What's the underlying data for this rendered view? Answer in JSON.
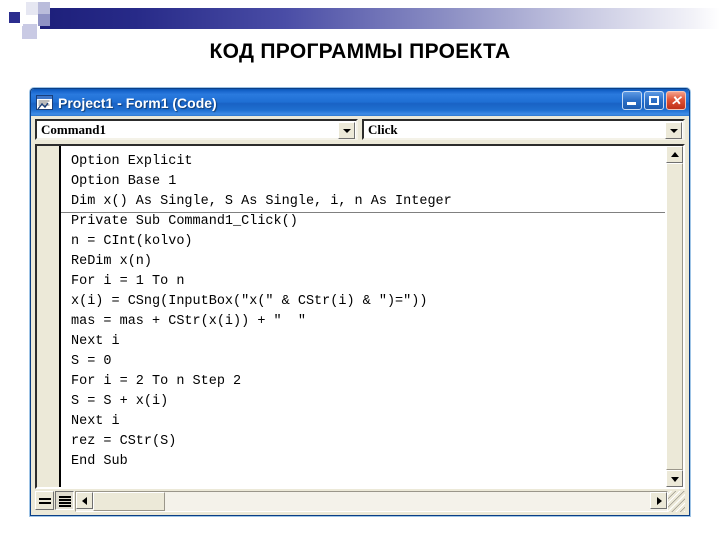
{
  "slide": {
    "heading": "КОД ПРОГРАММЫ ПРОЕКТА",
    "decoration": "blue-gradient-banner"
  },
  "window": {
    "title": "Project1 - Form1 (Code)",
    "icon": "vb-code-window-icon",
    "controls": {
      "minimize_label": "_",
      "maximize_label": "□",
      "close_label": "✕"
    },
    "colors": {
      "titlebar_start": "#2a7ade",
      "titlebar_end": "#1962c4",
      "close_red": "#df5336",
      "face": "#ece9d8",
      "code_background": "#ffffff",
      "code_text": "#000000"
    }
  },
  "toolbar": {
    "object_combo": {
      "value": "Command1",
      "arrow": "chevron-down-icon"
    },
    "procedure_combo": {
      "value": "Click",
      "arrow": "chevron-down-icon"
    }
  },
  "code": {
    "separator_after_line": 3,
    "lines": [
      "Option Explicit",
      "Option Base 1",
      "Dim x() As Single, S As Single, i, n As Integer",
      "Private Sub Command1_Click()",
      "n = CInt(kolvo)",
      "ReDim x(n)",
      "For i = 1 To n",
      "x(i) = CSng(InputBox(\"x(\" & CStr(i) & \")=\"))",
      "mas = mas + CStr(x(i)) + \"  \"",
      "Next i",
      "S = 0",
      "For i = 2 To n Step 2",
      "S = S + x(i)",
      "Next i",
      "rez = CStr(S)",
      "End Sub"
    ]
  },
  "bottombar": {
    "procedure_view_label": "procedure-view",
    "full_module_view_label": "full-module-view"
  },
  "scrollbars": {
    "vertical_up": "scroll-up-arrow",
    "vertical_down": "scroll-down-arrow",
    "horizontal_left": "scroll-left-arrow",
    "horizontal_right": "scroll-right-arrow"
  }
}
